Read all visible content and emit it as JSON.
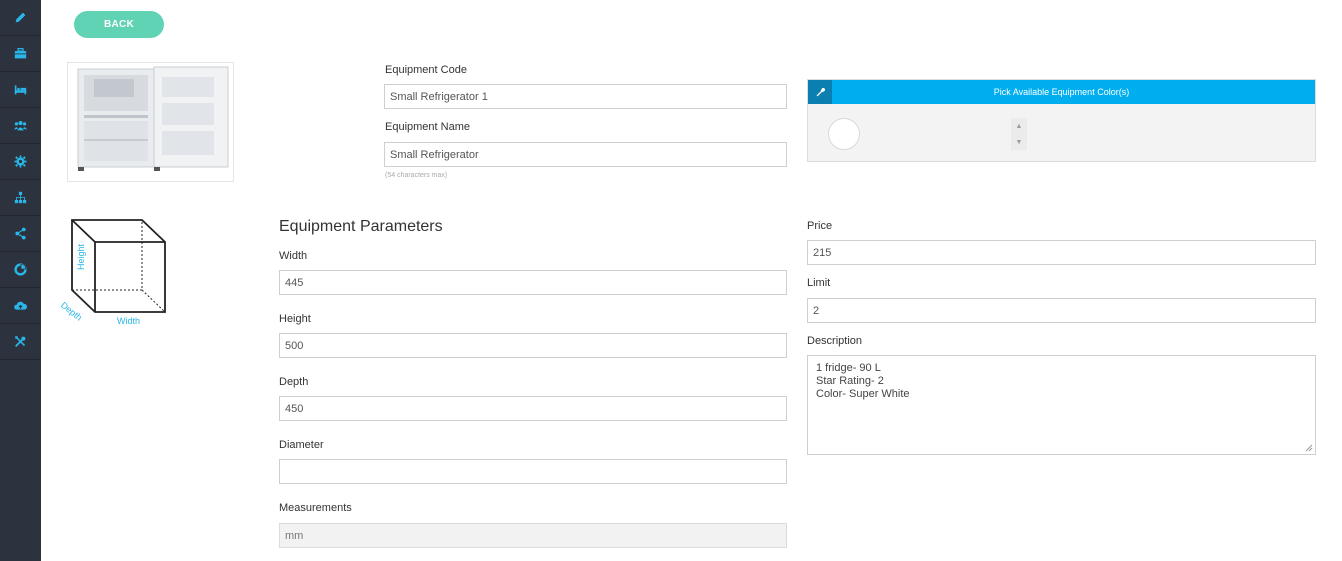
{
  "sidebar": {
    "items": [
      {
        "icon": "pencil-icon"
      },
      {
        "icon": "briefcase-icon"
      },
      {
        "icon": "bed-icon"
      },
      {
        "icon": "users-icon"
      },
      {
        "icon": "gear-icon"
      },
      {
        "icon": "sitemap-icon"
      },
      {
        "icon": "share-icon"
      },
      {
        "icon": "chart-pie-icon"
      },
      {
        "icon": "cloud-upload-icon"
      },
      {
        "icon": "tools-icon"
      }
    ],
    "bg_color": "#2c323e",
    "icon_color": "#29b6e8"
  },
  "back_button": {
    "label": "BACK",
    "color": "#5fd3b3"
  },
  "equipment_code": {
    "label": "Equipment Code",
    "value": "Small Refrigerator 1"
  },
  "equipment_name": {
    "label": "Equipment Name",
    "value": "Small Refrigerator",
    "hint": "(54 characters max)"
  },
  "color_picker": {
    "header": "Pick Available Equipment Color(s)",
    "header_color": "#00aeef"
  },
  "diagram": {
    "height_label": "Height",
    "depth_label": "Depth",
    "width_label": "Width"
  },
  "parameters": {
    "title": "Equipment Parameters",
    "width": {
      "label": "Width",
      "value": "445"
    },
    "height": {
      "label": "Height",
      "value": "500"
    },
    "depth": {
      "label": "Depth",
      "value": "450"
    },
    "diameter": {
      "label": "Diameter",
      "value": ""
    },
    "measurements": {
      "label": "Measurements",
      "value": "mm"
    }
  },
  "price": {
    "label": "Price",
    "value": "215"
  },
  "limit": {
    "label": "Limit",
    "value": "2"
  },
  "description": {
    "label": "Description",
    "lines": [
      "1 fridge- 90 L",
      "Star Rating- 2",
      "Color- Super White"
    ]
  }
}
